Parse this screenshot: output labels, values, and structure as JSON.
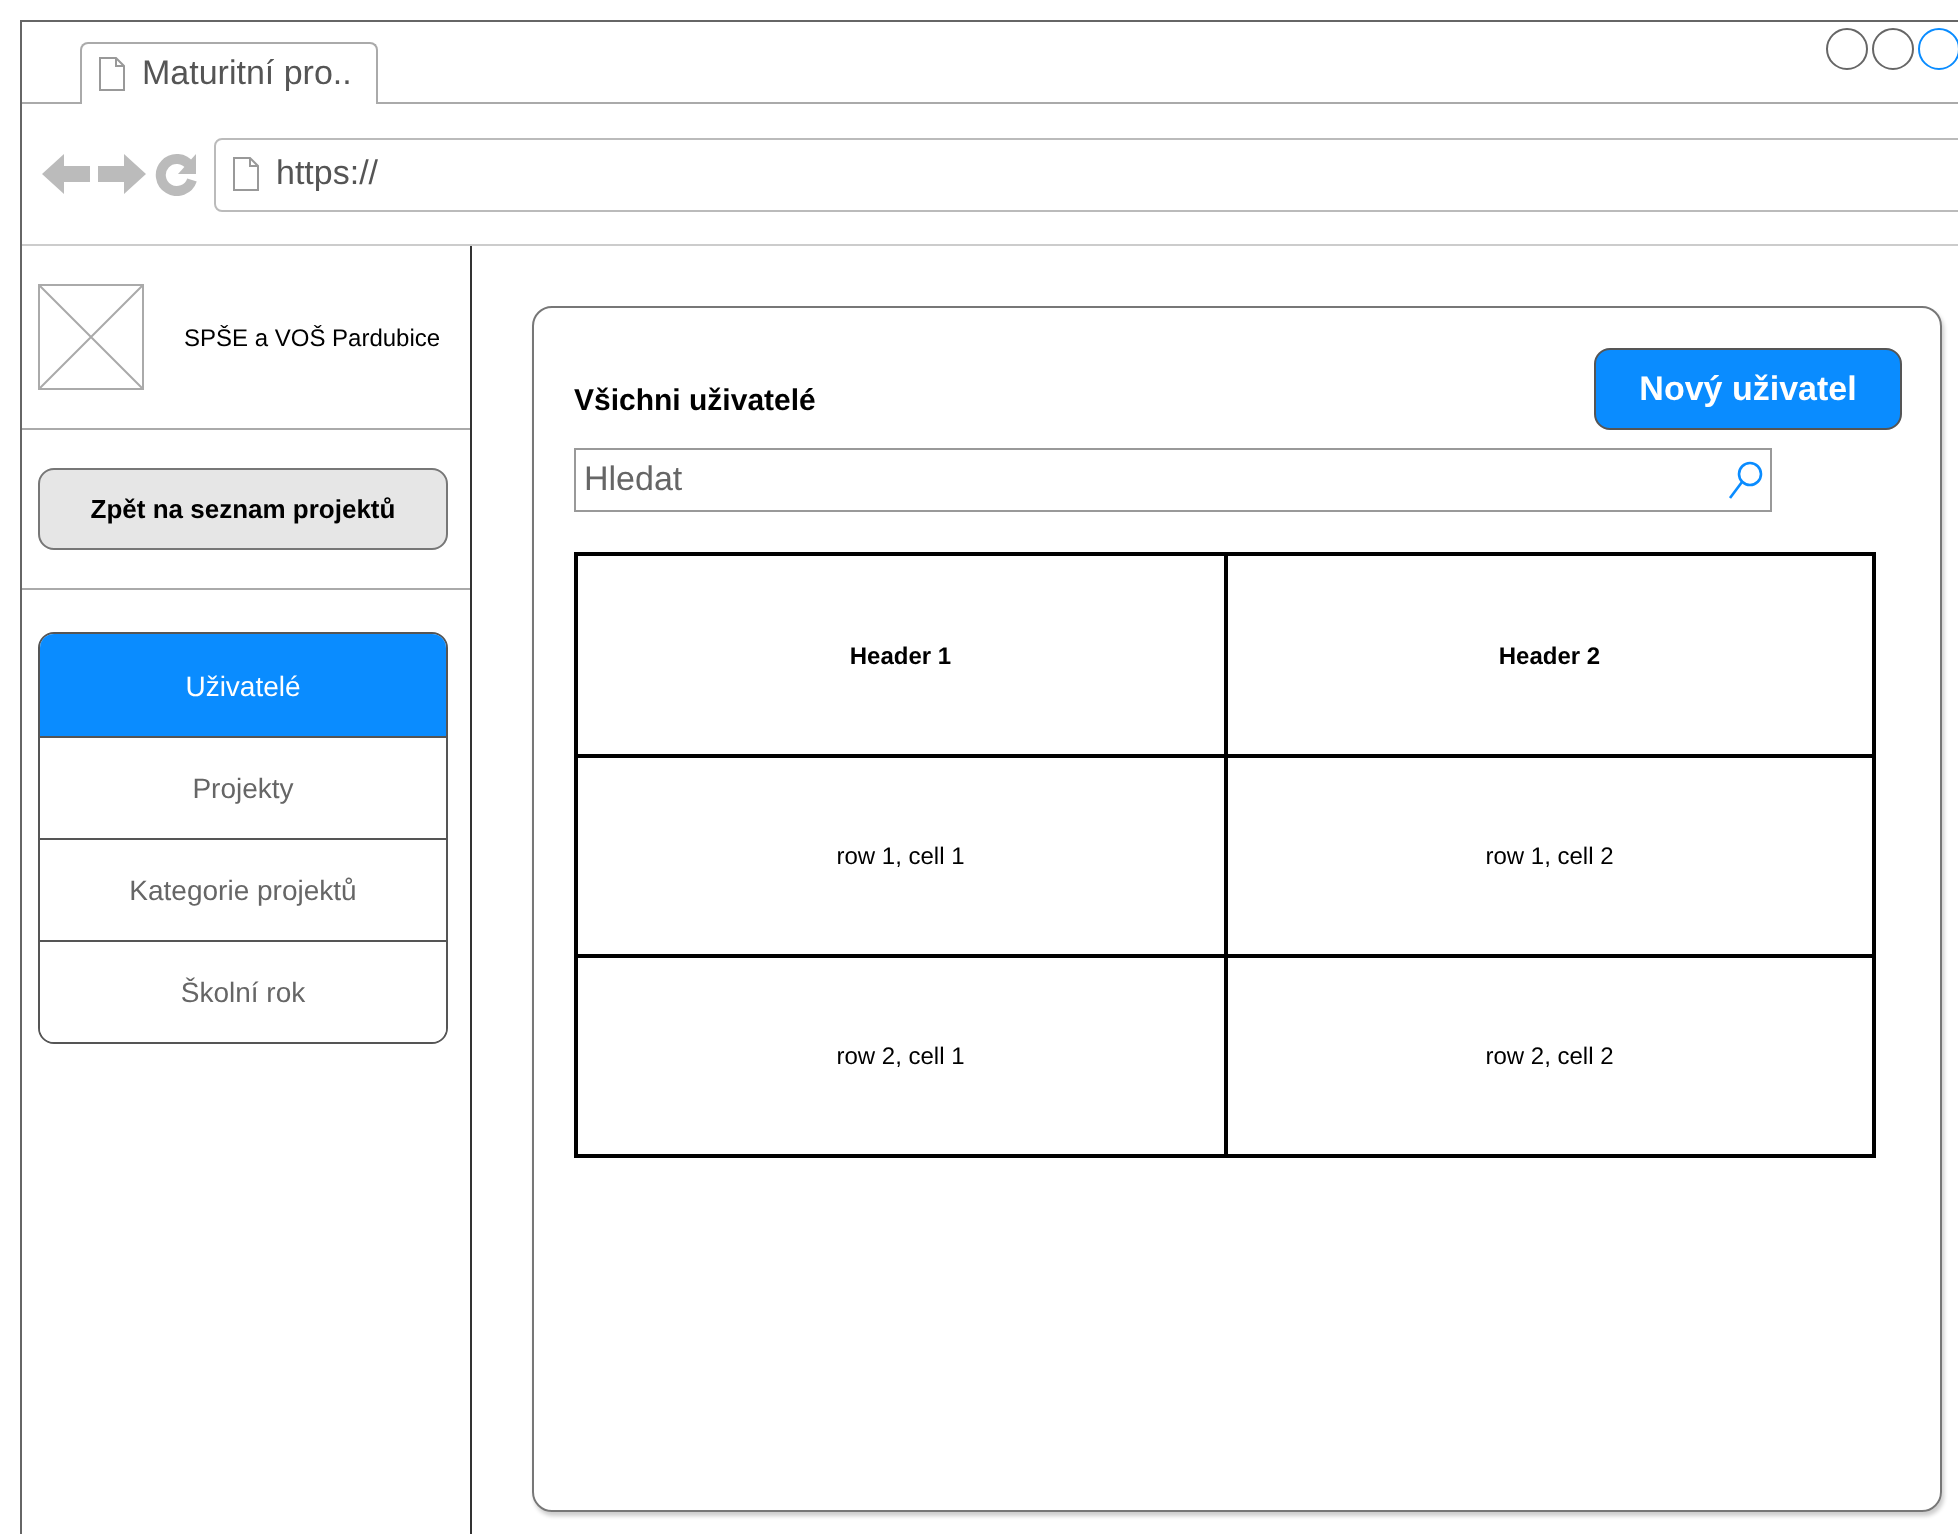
{
  "browser": {
    "tab_title": "Maturitní pro..",
    "url": "https://"
  },
  "sidebar": {
    "brand": "SPŠE a VOŠ Pardubice",
    "back_button": "Zpět na seznam projektů",
    "items": [
      {
        "label": "Uživatelé",
        "selected": true
      },
      {
        "label": "Projekty",
        "selected": false
      },
      {
        "label": "Kategorie projektů",
        "selected": false
      },
      {
        "label": "Školní rok",
        "selected": false
      }
    ]
  },
  "main": {
    "title": "Všichni uživatelé",
    "new_button": "Nový uživatel",
    "search": {
      "placeholder": "Hledat"
    },
    "table": {
      "columns": [
        "Header 1",
        "Header 2"
      ],
      "rows": [
        [
          "row 1, cell 1",
          "row 1, cell 2"
        ],
        [
          "row 2, cell 1",
          "row 2, cell 2"
        ]
      ]
    }
  }
}
